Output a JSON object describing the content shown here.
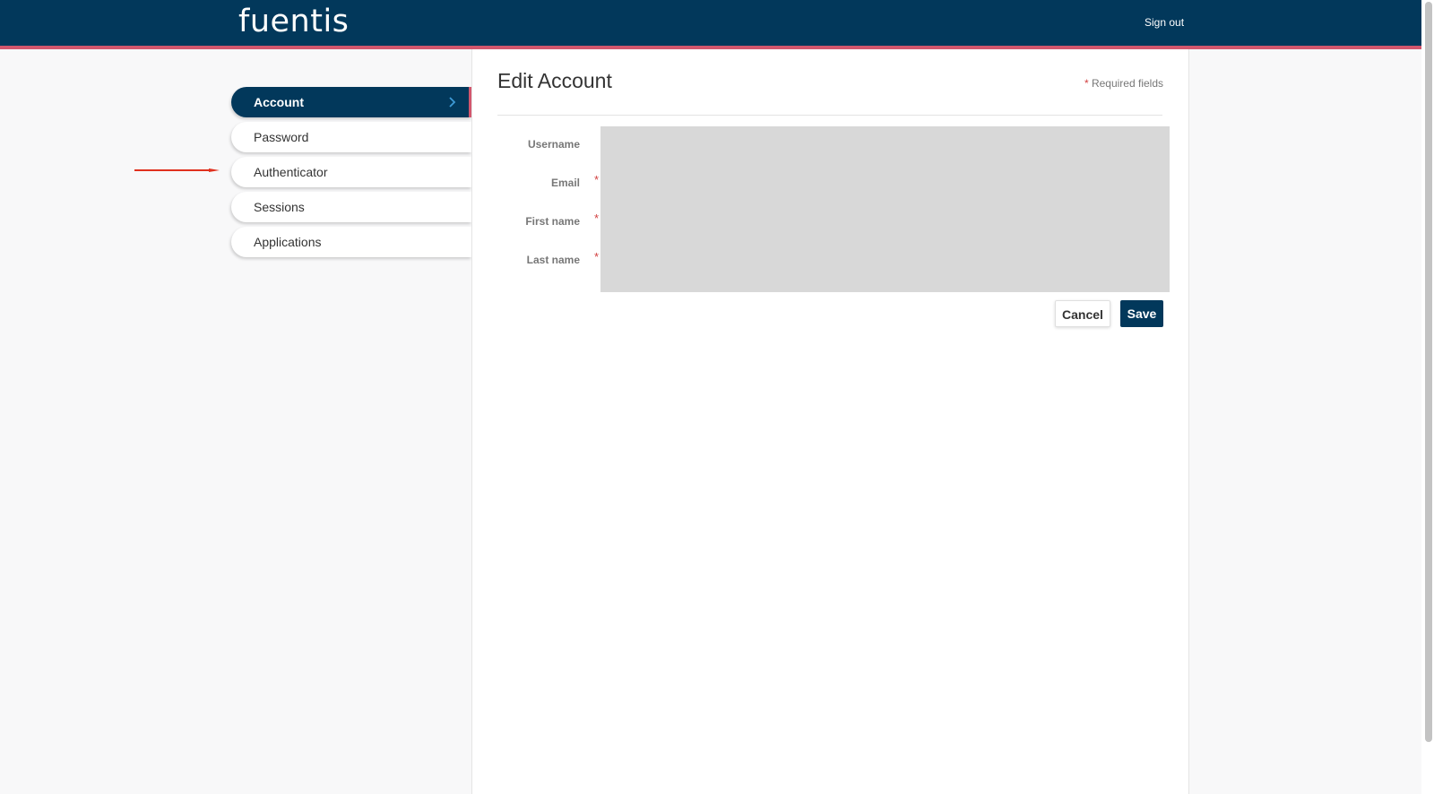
{
  "header": {
    "logo_text": "fuentis",
    "signout_label": "Sign out"
  },
  "sidebar": {
    "items": [
      {
        "label": "Account",
        "active": true
      },
      {
        "label": "Password",
        "active": false
      },
      {
        "label": "Authenticator",
        "active": false
      },
      {
        "label": "Sessions",
        "active": false
      },
      {
        "label": "Applications",
        "active": false
      }
    ],
    "chevron_icon": "chevron-right-icon"
  },
  "main": {
    "title": "Edit Account",
    "required_star": "*",
    "required_note": "Required fields",
    "fields": [
      {
        "label": "Username",
        "required": false
      },
      {
        "label": "Email",
        "required": true
      },
      {
        "label": "First name",
        "required": true
      },
      {
        "label": "Last name",
        "required": true
      }
    ],
    "cancel_label": "Cancel",
    "save_label": "Save"
  },
  "colors": {
    "header_bg": "#02385b",
    "accent_stripe": "#d2566d",
    "annotation_arrow": "#e0301e",
    "required_star": "#d24040"
  }
}
